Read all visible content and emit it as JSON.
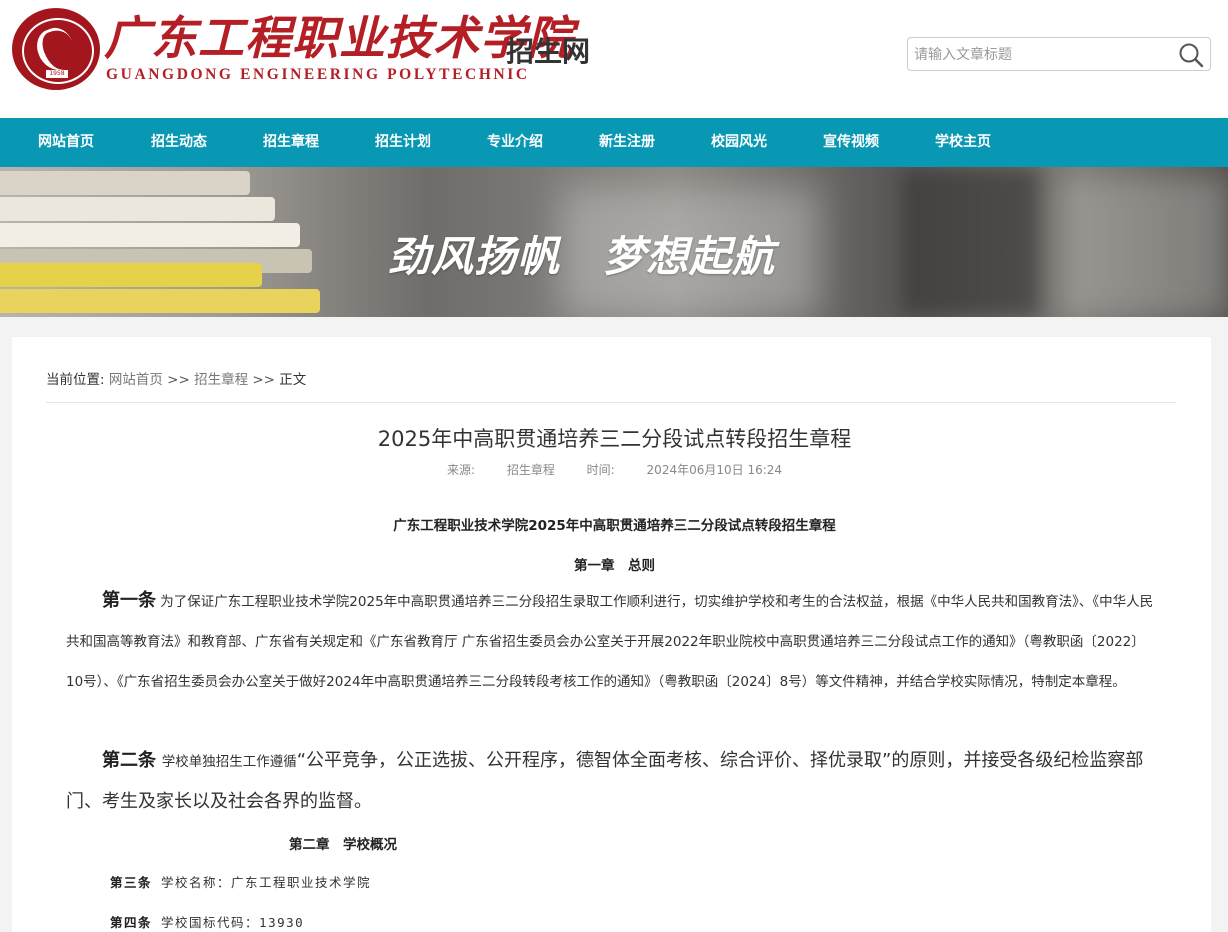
{
  "header": {
    "logo_cn": "广东工程职业技术学院",
    "logo_en": "GUANGDONG ENGINEERING POLYTECHNIC",
    "seal_year": "1958",
    "site_name": "招生网",
    "search_placeholder": "请输入文章标题"
  },
  "nav": {
    "items": [
      "网站首页",
      "招生动态",
      "招生章程",
      "招生计划",
      "专业介绍",
      "新生注册",
      "校园风光",
      "宣传视频",
      "学校主页"
    ]
  },
  "banner": {
    "slogan": "劲风扬帆　梦想起航"
  },
  "breadcrumb": {
    "prefix": "当前位置:",
    "items": [
      "网站首页",
      "招生章程",
      "正文"
    ],
    "separator": ">>"
  },
  "article": {
    "title": "2025年中高职贯通培养三二分段试点转段招生章程",
    "source_label": "来源:",
    "source": "招生章程",
    "time_label": "时间:",
    "time": "2024年06月10日 16:24",
    "heading": "广东工程职业技术学院2025年中高职贯通培养三二分段试点转段招生章程",
    "chapter1": "第一章　总则",
    "article1_label": "第一条",
    "article1_text": "为了保证广东工程职业技术学院2025年中高职贯通培养三二分段招生录取工作顺利进行，切实维护学校和考生的合法权益，根据《中华人民共和国教育法》、《中华人民共和国高等教育法》和教育部、广东省有关规定和《广东省教育厅 广东省招生委员会办公室关于开展2022年职业院校中高职贯通培养三二分段试点工作的通知》（粤教职函〔2022〕10号）、《广东省招生委员会办公室关于做好2024年中高职贯通培养三二分段转段考核工作的通知》（粤教职函〔2024〕8号）等文件精神，并结合学校实际情况，特制定本章程。",
    "article2_label": "第二条",
    "article2_small": "学校单独招生工作遵循",
    "article2_text": "“公平竞争，公正选拔、公开程序，德智体全面考核、综合评价、择优录取”的原则，并接受各级纪检监察部门、考生及家长以及社会各界的监督。",
    "chapter2": "第二章　学校概况",
    "article3_label": "第三条",
    "article3_text": "学校名称：广东工程职业技术学院",
    "article4_label": "第四条",
    "article4_text": "学校国标代码：13930"
  },
  "colors": {
    "brand_red": "#b41e25",
    "nav_bg": "#0998b3"
  }
}
